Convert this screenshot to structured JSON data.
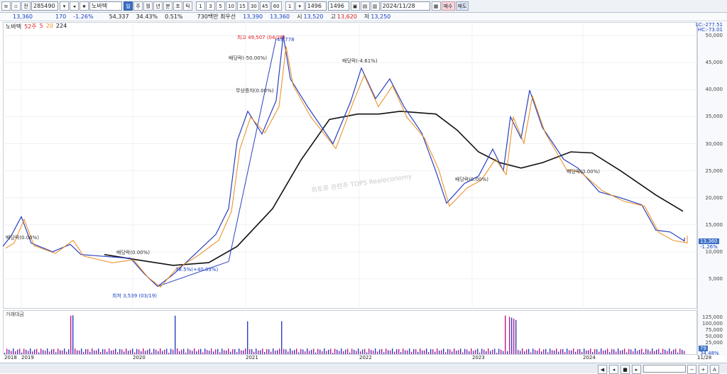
{
  "toolbar": {
    "code": "285490",
    "name": "노바텍",
    "buttons": [
      "일",
      "주",
      "월",
      "년",
      "분",
      "초",
      "틱"
    ],
    "numbers": [
      "1",
      "3",
      "5",
      "10",
      "15",
      "30",
      "45",
      "60"
    ],
    "count1": "1496",
    "count2": "1496",
    "date": "2024/11/28",
    "buy_label": "매수",
    "sell_label": "매도"
  },
  "quote": {
    "price": "13,360",
    "change": "170",
    "change_pct": "-1.26%",
    "volume": "54,337",
    "turnover_pct": "34.43%",
    "ratio": "0.51%",
    "amount": "730백만 최우선",
    "ask": "13,390",
    "bid": "13,360",
    "open_label": "시",
    "open": "13,520",
    "high_label": "고",
    "high": "13,620",
    "low_label": "저",
    "low": "13,250"
  },
  "legend": {
    "name": "노바텍",
    "ma5": "5",
    "ma20": "20",
    "ma224": "224",
    "prefix": "52주"
  },
  "annotations": {
    "high": "최고 49,507 (04/26)",
    "low": "최저 3,539 (03/19)",
    "mid_label": "78.5%(+40.03%)",
    "div1": "배당락(-50.00%)",
    "div2": "배당락(-4.61%)",
    "rights": "무상증자(0.00%)",
    "div3": "배당락(0.00%)",
    "div4": "배당락(0.00%)",
    "div5": "배당락(0.00%)",
    "div6": "배당락(0.00%)",
    "top_label": "49,778"
  },
  "watermark": "희토류 관련주 TOPS Realeconomy",
  "y_axis": {
    "top_labels": [
      "LC:-277.51",
      "HC:-73.01"
    ],
    "ticks": [
      "50,000",
      "45,000",
      "40,000",
      "35,000",
      "30,000",
      "25,000",
      "20,000",
      "15,000",
      "10,000",
      "5,000"
    ],
    "current": "13,360",
    "current_pct": "-1.26%"
  },
  "vol_axis": {
    "label": "거래대금",
    "ticks": [
      "125,000",
      "100,000",
      "75,000",
      "50,000",
      "25,000"
    ],
    "current": "79",
    "pct": "34.48%"
  },
  "x_axis": {
    "labels": [
      "2018",
      "2019",
      "2020",
      "2021",
      "2022",
      "2023",
      "2024",
      "11/28"
    ]
  },
  "chart_data": {
    "type": "line",
    "title": "",
    "series": [
      {
        "name": "",
        "x": [
          "2018",
          "2019",
          "2020",
          "2021",
          "2022",
          "2023",
          "2024",
          "11/28"
        ],
        "values": [
          11000,
          10000,
          7500,
          26000,
          40000,
          26000,
          33000,
          13360
        ]
      },
      {
        "name": "",
        "x": [
          "2019-06",
          "2020",
          "2021",
          "2022",
          "2023",
          "2024",
          "11/28"
        ],
        "values": [
          9500,
          7600,
          10500,
          36000,
          29000,
          28500,
          17500
        ]
      }
    ],
    "ylim": [
      0,
      52000
    ],
    "annotations": [
      "최고 49,507 (04/26)",
      "최저 3,539 (03/19)"
    ]
  }
}
